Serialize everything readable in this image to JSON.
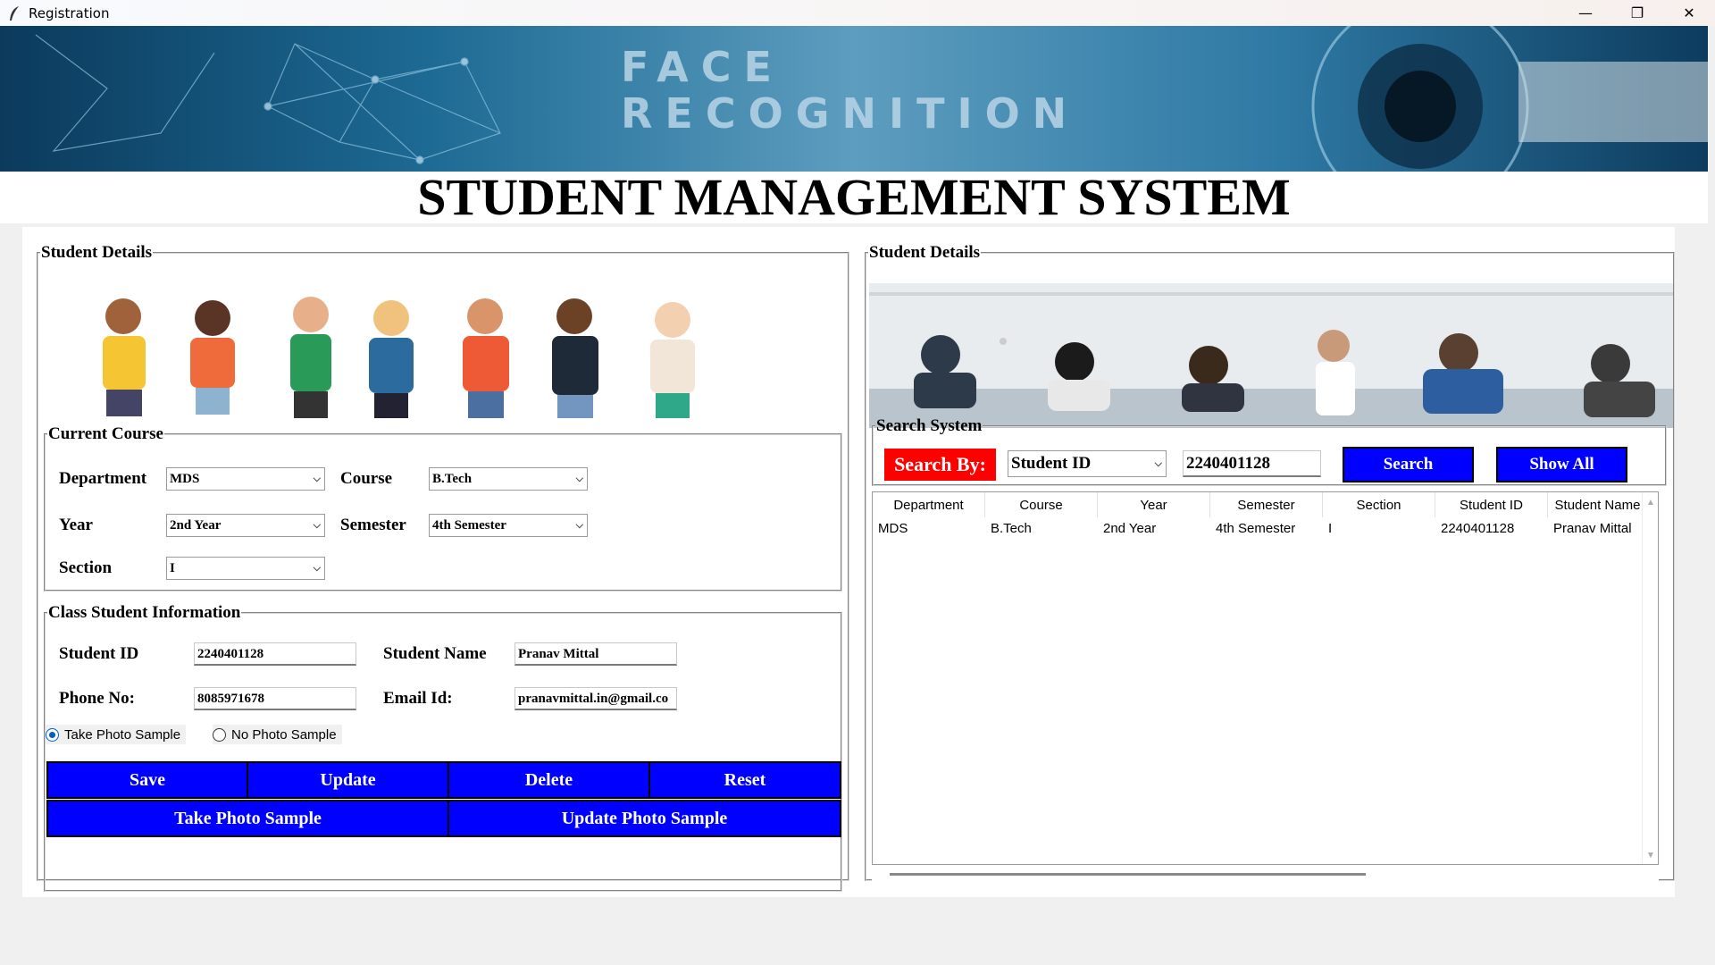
{
  "window": {
    "title": "Registration",
    "minimize": "—",
    "maximize": "❐",
    "close": "✕"
  },
  "banner": {
    "line1": "FACE",
    "line2": "RECOGNITION"
  },
  "page_title": "STUDENT MANAGEMENT SYSTEM",
  "left": {
    "frame_title": "Student Details",
    "current_course": {
      "title": "Current Course",
      "department_label": "Department",
      "department_value": "MDS",
      "course_label": "Course",
      "course_value": "B.Tech",
      "year_label": "Year",
      "year_value": "2nd Year",
      "semester_label": "Semester",
      "semester_value": "4th Semester",
      "section_label": "Section",
      "section_value": "I"
    },
    "class_info": {
      "title": "Class Student Information",
      "student_id_label": "Student ID",
      "student_id_value": "2240401128",
      "student_name_label": "Student Name",
      "student_name_value": "Pranav Mittal",
      "phone_label": "Phone No:",
      "phone_value": "8085971678",
      "email_label": "Email Id:",
      "email_value": "pranavmittal.in@gmail.co",
      "radio_take": "Take Photo Sample",
      "radio_take_selected": true,
      "radio_no": "No Photo Sample",
      "radio_no_selected": false
    },
    "buttons": {
      "save": "Save",
      "update": "Update",
      "delete": "Delete",
      "reset": "Reset",
      "take_photo": "Take Photo Sample",
      "update_photo": "Update Photo Sample"
    }
  },
  "right": {
    "frame_title": "Student Details",
    "search": {
      "title": "Search System",
      "by_label": "Search By:",
      "by_value": "Student ID",
      "query": "2240401128",
      "search_button": "Search",
      "show_all_button": "Show All"
    },
    "table": {
      "columns": [
        "Department",
        "Course",
        "Year",
        "Semester",
        "Section",
        "Student ID",
        "Student Name"
      ],
      "rows": [
        [
          "MDS",
          "B.Tech",
          "2nd Year",
          "4th Semester",
          "I",
          "2240401128",
          "Pranav Mittal"
        ]
      ]
    }
  },
  "colors": {
    "button_blue": "#0000ff",
    "search_label_red": "#ff0000",
    "radio_accent": "#0060c0"
  }
}
